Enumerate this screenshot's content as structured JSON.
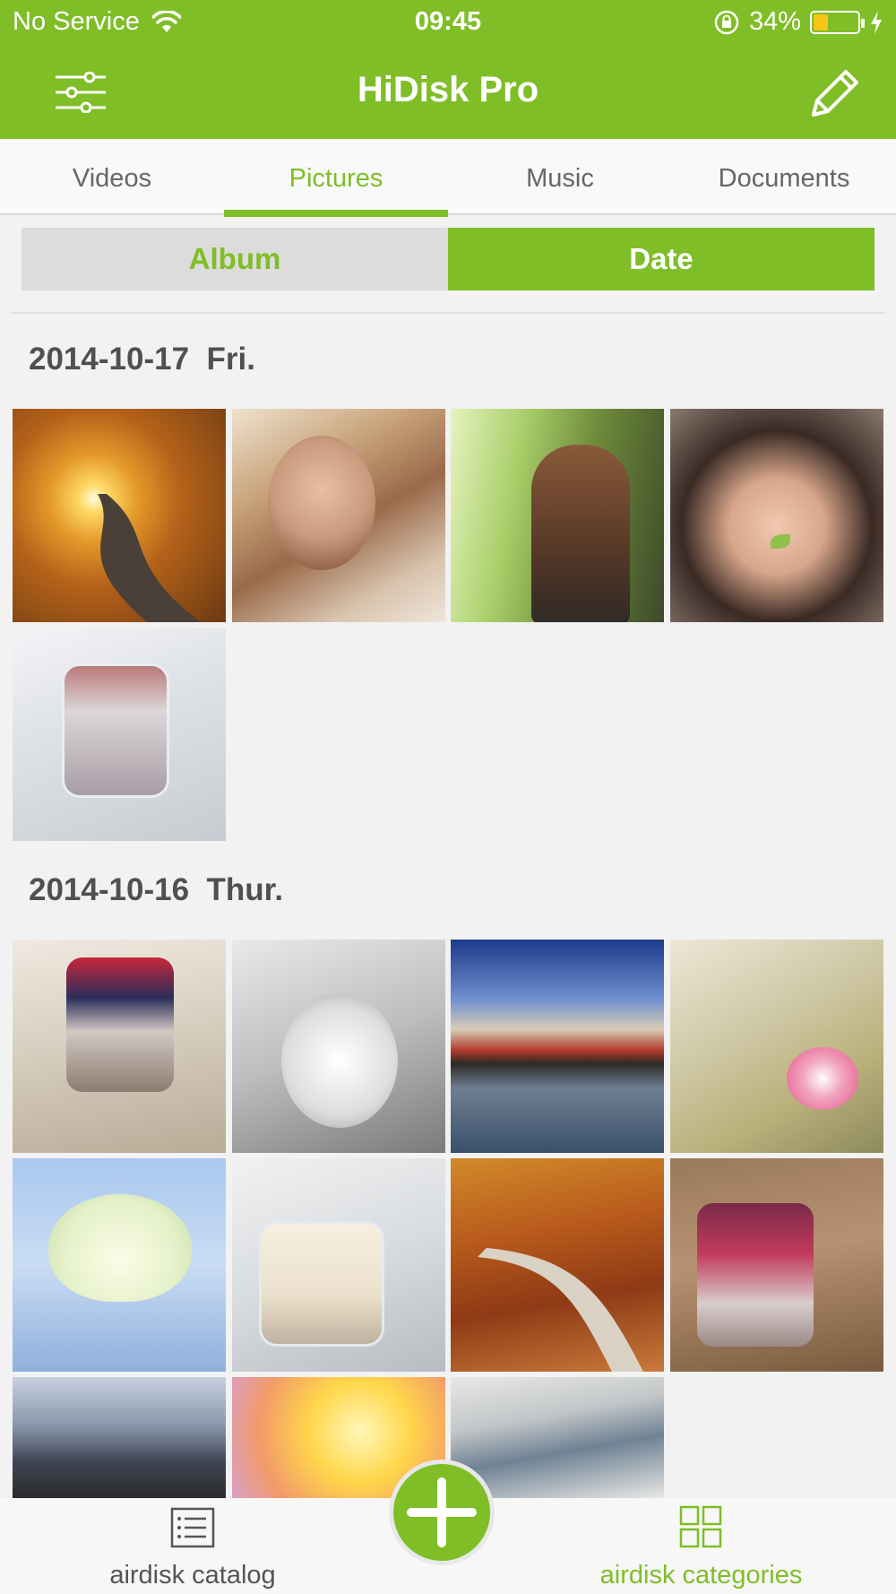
{
  "status_bar": {
    "carrier": "No Service",
    "time": "09:45",
    "battery_percent": "34%",
    "battery_level": 0.34,
    "icons": [
      "wifi-icon",
      "rotation-lock-icon",
      "battery-icon",
      "charging-icon"
    ]
  },
  "nav": {
    "title": "HiDisk Pro",
    "left_icon": "sliders-menu-icon",
    "right_icon": "pencil-edit-icon"
  },
  "tabs": [
    {
      "label": "Videos",
      "active": false
    },
    {
      "label": "Pictures",
      "active": true
    },
    {
      "label": "Music",
      "active": false
    },
    {
      "label": "Documents",
      "active": false
    }
  ],
  "segment": {
    "album_label": "Album",
    "date_label": "Date",
    "selected": "Date"
  },
  "groups": [
    {
      "date": "2014-10-17",
      "day": "Fri.",
      "photo_count": 5,
      "photos": [
        "autumn-road-sunlight",
        "woman-portrait",
        "girl-in-sunlight",
        "child-with-leaf",
        "chia-pudding-with-figs"
      ]
    },
    {
      "date": "2014-10-16",
      "day": "Thur.",
      "photo_count": 11,
      "photos": [
        "berry-chia-jar",
        "child-with-rabbit",
        "seaside-houses",
        "pink-lotus",
        "white-lotus",
        "fig-yogurt-jar",
        "autumn-path",
        "raspberry-fig-jar",
        "desert-road",
        "yellow-sky-flower",
        "snowy-mountains"
      ]
    }
  ],
  "bottom_bar": {
    "catalog_label": "airdisk catalog",
    "categories_label": "airdisk categories",
    "catalog_icon": "list-icon",
    "categories_icon": "grid-icon",
    "add_icon": "plus-icon",
    "active": "categories"
  },
  "colors": {
    "accent": "#7fbe27",
    "text_gray": "#505050",
    "tab_gray": "#666666"
  }
}
